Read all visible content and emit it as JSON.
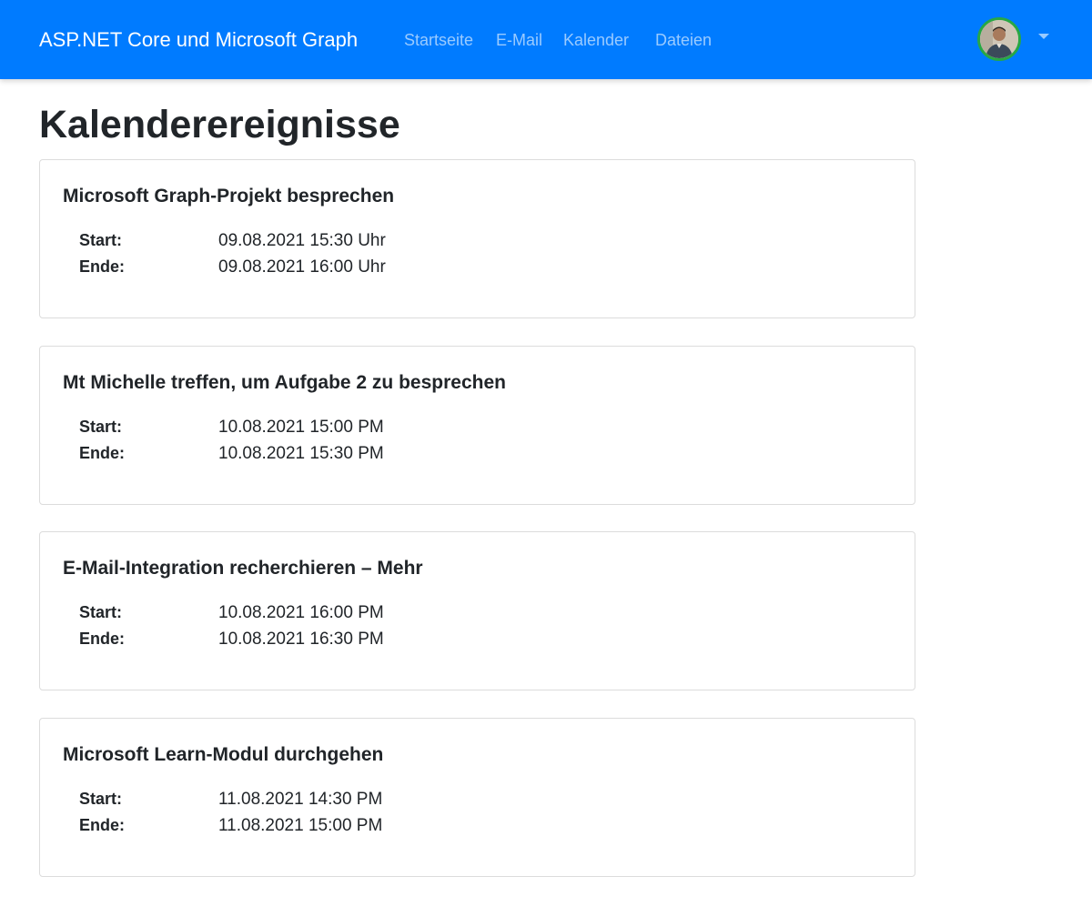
{
  "navbar": {
    "brand": "ASP.NET Core und Microsoft Graph",
    "links": [
      "Startseite",
      "E-Mail",
      "Kalender",
      "Dateien"
    ],
    "accent_color": "#007bff",
    "avatar_ring_color": "#28a745"
  },
  "page": {
    "title": "Kalenderereignisse"
  },
  "labels": {
    "start": "Start:",
    "end": "Ende:"
  },
  "events": [
    {
      "subject": "Microsoft Graph-Projekt besprechen",
      "start": "09.08.2021 15:30 Uhr",
      "end": "09.08.2021 16:00 Uhr"
    },
    {
      "subject": "Mt Michelle treffen, um Aufgabe 2 zu besprechen",
      "start": "10.08.2021 15:00 PM",
      "end": "10.08.2021 15:30 PM"
    },
    {
      "subject": "E-Mail-Integration recherchieren – Mehr",
      "start": "10.08.2021 16:00 PM",
      "end": "10.08.2021 16:30 PM"
    },
    {
      "subject": "Microsoft Learn-Modul durchgehen",
      "start": "11.08.2021 14:30 PM",
      "end": "11.08.2021 15:00 PM"
    }
  ]
}
